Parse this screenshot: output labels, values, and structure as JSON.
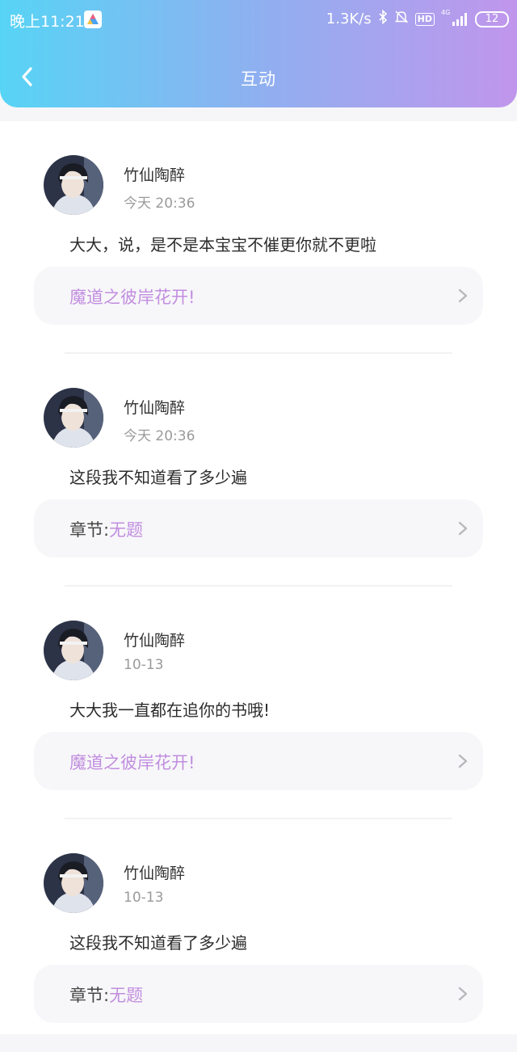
{
  "status_bar": {
    "time": "晚上11:21",
    "network_speed": "1.3K/s",
    "hd": "HD",
    "signal": "4G",
    "battery": "12"
  },
  "header": {
    "title": "互动"
  },
  "colors": {
    "gradient_start": "#57d4f5",
    "gradient_end": "#c096ec",
    "accent": "#c28ee0"
  },
  "items": [
    {
      "username": "竹仙陶醉",
      "time": "今天 20:36",
      "comment": "大大，说，是不是本宝宝不催更你就不更啦",
      "link_prefix": "",
      "link_text": "魔道之彼岸花开!"
    },
    {
      "username": "竹仙陶醉",
      "time": "今天 20:36",
      "comment": "这段我不知道看了多少遍",
      "link_prefix": "章节:",
      "link_text": "无题"
    },
    {
      "username": "竹仙陶醉",
      "time": "10-13",
      "comment": "大大我一直都在追你的书哦!",
      "link_prefix": "",
      "link_text": "魔道之彼岸花开!"
    },
    {
      "username": "竹仙陶醉",
      "time": "10-13",
      "comment": "这段我不知道看了多少遍",
      "link_prefix": "章节:",
      "link_text": "无题"
    }
  ]
}
